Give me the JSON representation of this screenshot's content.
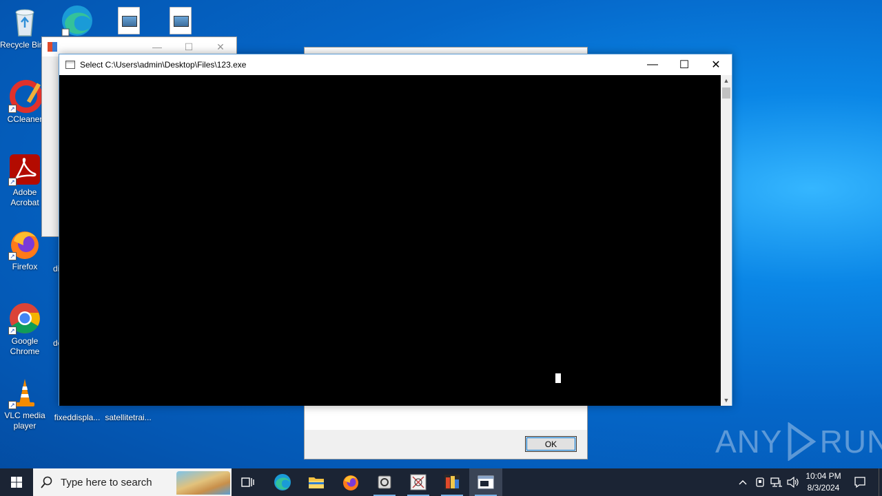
{
  "desktop": {
    "icons": [
      {
        "label": "Recycle Bin",
        "icon": "recycle-bin-icon"
      },
      {
        "label": "CCleaner",
        "icon": "ccleaner-icon"
      },
      {
        "label": "Adobe\nAcrobat",
        "icon": "adobe-acrobat-icon"
      },
      {
        "label": "Firefox",
        "icon": "firefox-icon"
      },
      {
        "label": "Google\nChrome",
        "icon": "chrome-icon"
      },
      {
        "label": "VLC media\nplayer",
        "icon": "vlc-icon"
      }
    ],
    "partial_labels": {
      "col2_a": "di",
      "col2_b": "de",
      "file1": "fixeddispla...",
      "file2": "satellitetrai..."
    }
  },
  "console_window": {
    "title": "Select C:\\Users\\admin\\Desktop\\Files\\123.exe",
    "minimize": "—",
    "maximize": "☐",
    "close": "✕"
  },
  "background_window": {
    "minimize": "—",
    "maximize": "☐",
    "close": "✕"
  },
  "message_box": {
    "ok_label": "OK"
  },
  "watermark": {
    "left": "ANY",
    "right": "RUN"
  },
  "taskbar": {
    "search_placeholder": "Type here to search",
    "apps": [
      "task-view",
      "edge",
      "file-explorer",
      "firefox",
      "app-5",
      "app-6",
      "app-7",
      "console"
    ],
    "time": "10:04 PM",
    "date": "8/3/2024"
  },
  "colors": {
    "taskbar": "#1b2434",
    "accent": "#0078d7",
    "desktop": "#0567c9"
  }
}
